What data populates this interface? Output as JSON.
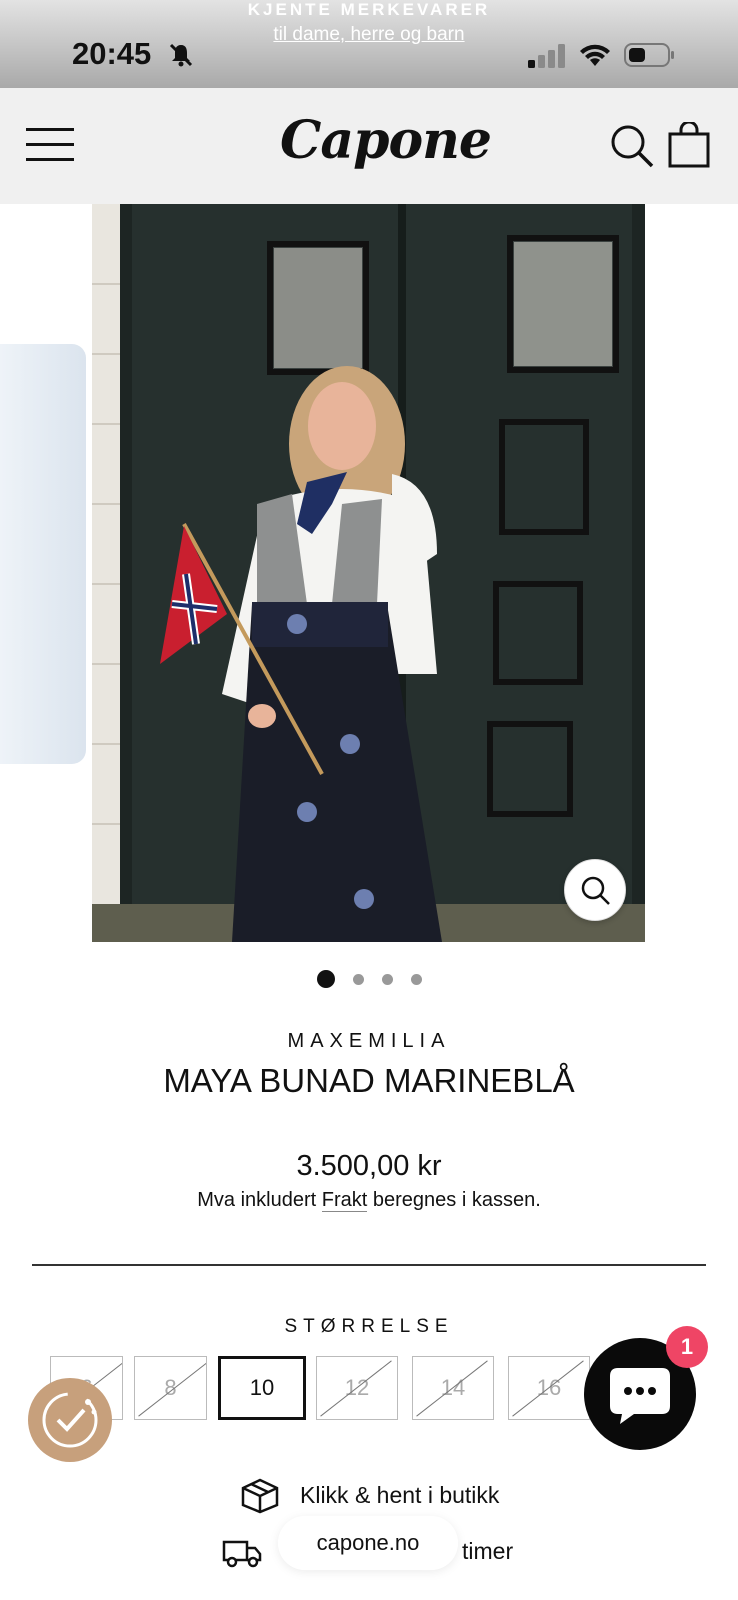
{
  "announcement": {
    "title": "KJENTE MERKEVARER",
    "link": "til dame, herre og barn"
  },
  "status_bar": {
    "time": "20:45",
    "icons": [
      "bell-muted-icon",
      "signal-icon",
      "wifi-icon",
      "battery-icon"
    ]
  },
  "header": {
    "logo": "Capone",
    "icons": [
      "menu-icon",
      "search-icon",
      "cart-icon"
    ]
  },
  "gallery": {
    "slide_count": 4,
    "active_slide": 1,
    "zoom_icon": "zoom-icon"
  },
  "product": {
    "brand": "MAXEMILIA",
    "title": "MAYA BUNAD MARINEBLÅ",
    "price": "3.500,00 kr",
    "tax_prefix": "Mva inkludert ",
    "tax_link": "Frakt",
    "tax_suffix": " beregnes i kassen."
  },
  "sizes": {
    "label": "STØRRELSE",
    "options": [
      {
        "label": "6",
        "available": false
      },
      {
        "label": "8",
        "available": false
      },
      {
        "label": "10",
        "available": true,
        "selected": true
      },
      {
        "label": "12",
        "available": false
      },
      {
        "label": "14",
        "available": false
      },
      {
        "label": "16",
        "available": false
      }
    ]
  },
  "features": [
    {
      "icon": "box-icon",
      "text": "Klikk & hent i butikk"
    },
    {
      "icon": "truck-icon",
      "text": "timer"
    }
  ],
  "chat": {
    "badge": "1"
  },
  "browser": {
    "url": "capone.no"
  },
  "colors": {
    "accent": "#ef4565",
    "cookie": "#c7a07c",
    "text": "#111111"
  }
}
